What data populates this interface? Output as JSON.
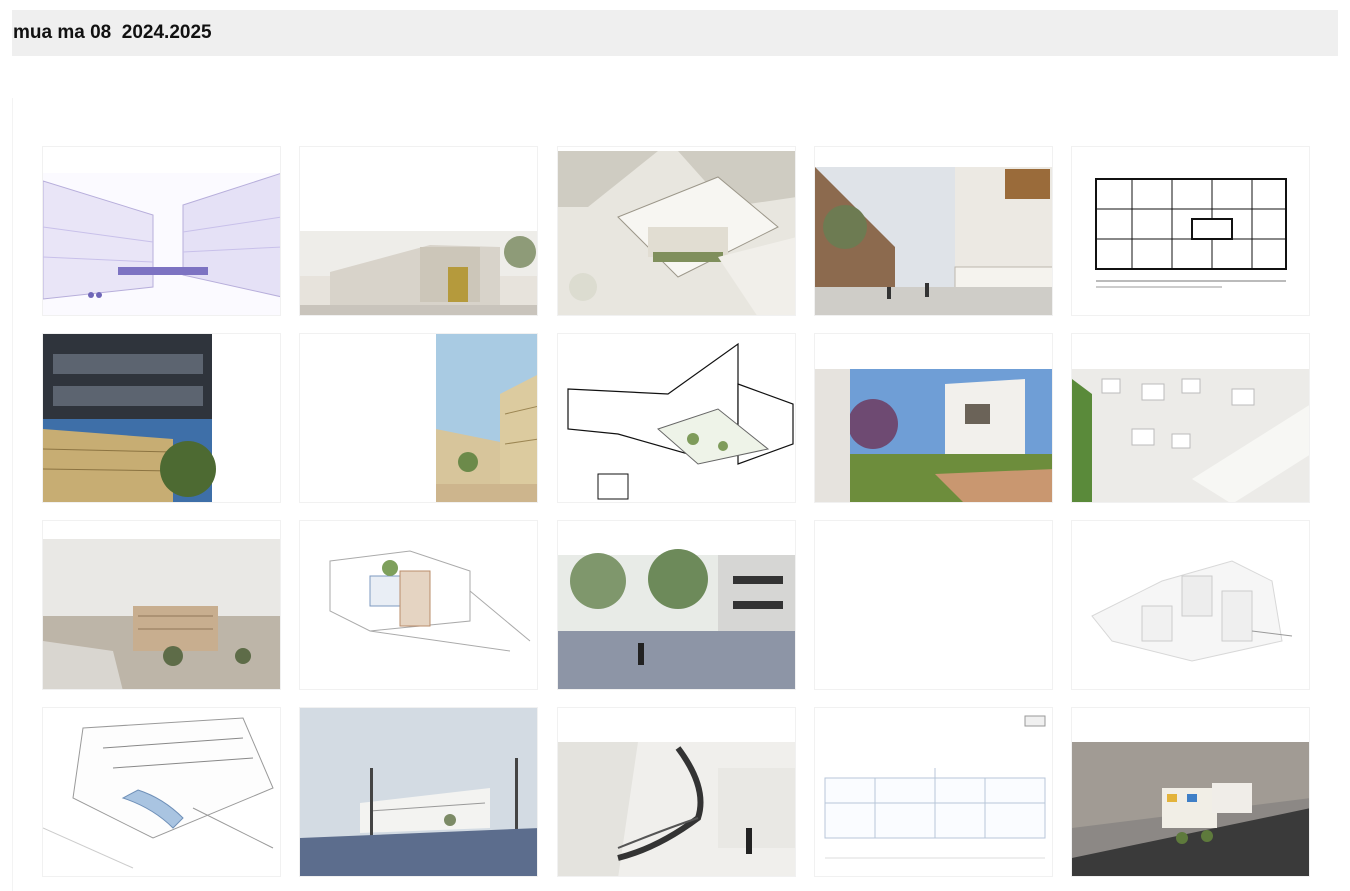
{
  "page": {
    "title": "mua ma 08  2024.2025"
  },
  "gallery": {
    "items": [
      {
        "kind": "violet-linework-courtyard-perspective"
      },
      {
        "kind": "street-render-with-yellow-facade"
      },
      {
        "kind": "aerial-city-block-model"
      },
      {
        "kind": "street-perspective-wooden-shutters"
      },
      {
        "kind": "floor-plan-drawing"
      },
      {
        "kind": "dark-facade-and-gold-facade-photo"
      },
      {
        "kind": "beige-building-courtyard-render"
      },
      {
        "kind": "exploded-line-axonometric"
      },
      {
        "kind": "garden-villa-render"
      },
      {
        "kind": "white-massing-aerial"
      },
      {
        "kind": "building-context-aerial-render"
      },
      {
        "kind": "line-sketch-axonometric"
      },
      {
        "kind": "plaza-with-trees-render"
      },
      {
        "kind": "blank-thumbnail"
      },
      {
        "kind": "white-cluster-model"
      },
      {
        "kind": "urban-linework-plan"
      },
      {
        "kind": "street-with-lamps-render"
      },
      {
        "kind": "curved-ramp-interior-render"
      },
      {
        "kind": "section-drawing-sheet"
      },
      {
        "kind": "night-aerial-model-render"
      }
    ]
  },
  "colors": {
    "header_bg": "#efefef",
    "page_bg": "#ffffff",
    "thumb_border": "#f1f1f1"
  }
}
